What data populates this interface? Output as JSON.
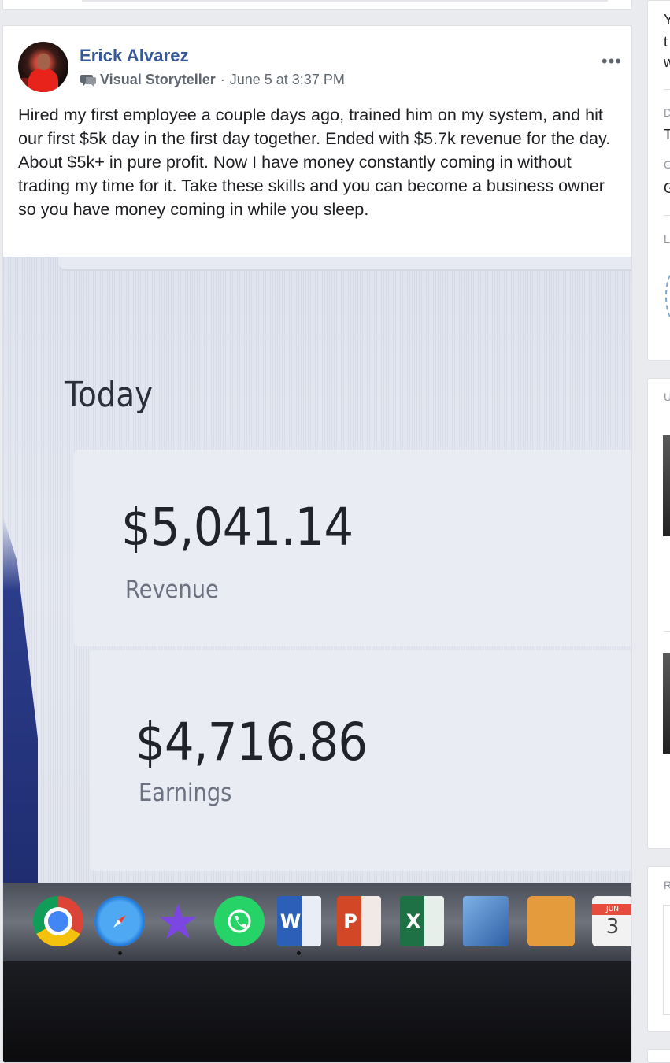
{
  "post": {
    "author": "Erick Alvarez",
    "badge": "Visual Storyteller",
    "separator": "·",
    "timestamp": "June 5 at 3:37 PM",
    "more_menu": "•••",
    "text": "Hired my first employee a couple days ago, trained him on my system, and hit our first $5k day in the first day together. Ended with $5.7k revenue for the day. About $5k+ in pure profit. Now I have money constantly coming in without trading my time for it. Take these skills and you can become a business owner so you have money coming in while you sleep."
  },
  "photo": {
    "heading": "Today",
    "revenue_value": "$5,041.14",
    "revenue_label": "Revenue",
    "earnings_value": "$4,716.86",
    "earnings_label": "Earnings",
    "dock_word": "W",
    "dock_ppt": "P",
    "dock_excel": "X",
    "dock_cal_month": "JUN",
    "dock_cal_day": "3"
  },
  "sidebar": {
    "line1": "Y",
    "line2": "t",
    "line3": "w",
    "line4": "D",
    "line5": "T",
    "line6": "G",
    "line7": "G",
    "line8": "L",
    "section2": "U",
    "section3": "R"
  }
}
